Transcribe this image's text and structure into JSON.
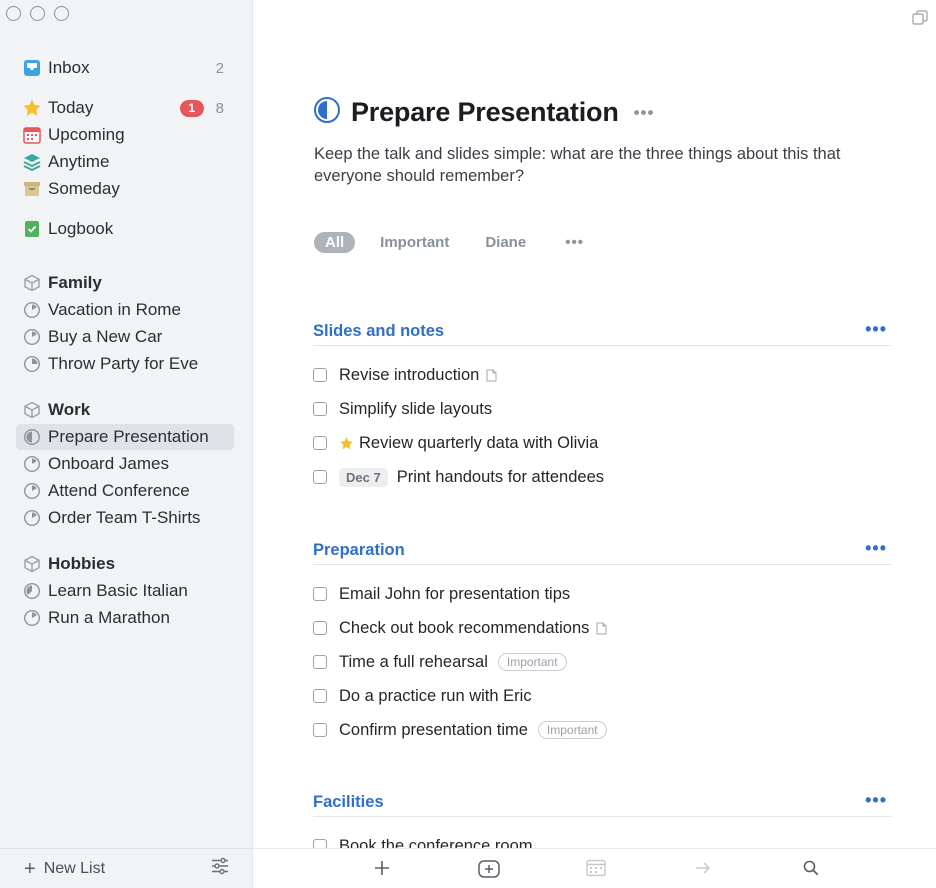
{
  "sidebar": {
    "lists": [
      {
        "label": "Inbox",
        "count": "2"
      },
      {
        "label": "Today",
        "badge": "1",
        "count": "8"
      },
      {
        "label": "Upcoming"
      },
      {
        "label": "Anytime"
      },
      {
        "label": "Someday"
      },
      {
        "label": "Logbook"
      }
    ],
    "areas": [
      {
        "label": "Family",
        "projects": [
          "Vacation in Rome",
          "Buy a New Car",
          "Throw Party for Eve"
        ]
      },
      {
        "label": "Work",
        "projects": [
          "Prepare Presentation",
          "Onboard James",
          "Attend Conference",
          "Order Team T-Shirts"
        ]
      },
      {
        "label": "Hobbies",
        "projects": [
          "Learn Basic Italian",
          "Run a Marathon"
        ]
      }
    ],
    "footer": {
      "new_list": "New List"
    }
  },
  "project": {
    "title": "Prepare Presentation",
    "notes": "Keep the talk and slides simple: what are the three things about this that everyone should remember?",
    "tag_filters": [
      "All",
      "Important",
      "Diane"
    ],
    "headings": [
      {
        "label": "Slides and notes",
        "tasks": [
          {
            "label": "Revise introduction"
          },
          {
            "label": "Simplify slide layouts"
          },
          {
            "label": "Review quarterly data with Olivia"
          },
          {
            "label": "Print handouts for attendees",
            "date": "Dec 7"
          }
        ]
      },
      {
        "label": "Preparation",
        "tasks": [
          {
            "label": "Email John for presentation tips"
          },
          {
            "label": "Check out book recommendations"
          },
          {
            "label": "Time a full rehearsal",
            "tag": "Important"
          },
          {
            "label": "Do a practice run with Eric"
          },
          {
            "label": "Confirm presentation time",
            "tag": "Important"
          }
        ]
      },
      {
        "label": "Facilities",
        "tasks": [
          {
            "label": "Book the conference room"
          }
        ]
      }
    ]
  },
  "colors": {
    "accent": "#2f6fc9",
    "badge": "#e5565d",
    "sidebar_bg": "#f1f3f5",
    "star": "#f5c02a"
  }
}
